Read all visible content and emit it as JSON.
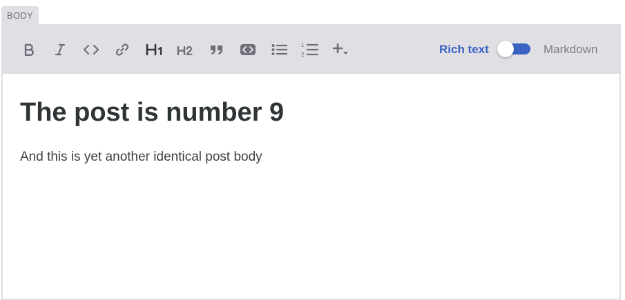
{
  "field": {
    "label": "BODY"
  },
  "toolbar": {
    "buttons": [
      {
        "name": "bold-button",
        "icon": "bold-icon"
      },
      {
        "name": "italic-button",
        "icon": "italic-icon"
      },
      {
        "name": "code-button",
        "icon": "code-icon"
      },
      {
        "name": "link-button",
        "icon": "link-icon"
      },
      {
        "name": "heading1-button",
        "icon": "heading1-icon",
        "text": "H1"
      },
      {
        "name": "heading2-button",
        "icon": "heading2-icon",
        "text": "H2"
      },
      {
        "name": "blockquote-button",
        "icon": "quote-icon"
      },
      {
        "name": "code-block-button",
        "icon": "code-block-icon"
      },
      {
        "name": "bullet-list-button",
        "icon": "bullet-list-icon"
      },
      {
        "name": "numbered-list-button",
        "icon": "numbered-list-icon"
      },
      {
        "name": "insert-more-button",
        "icon": "plus-dropdown-icon"
      }
    ],
    "mode": {
      "rich_text_label": "Rich text",
      "markdown_label": "Markdown",
      "active": "Rich text"
    }
  },
  "content": {
    "heading": "The post is number 9",
    "paragraph": "And this is yet another identical post body"
  },
  "colors": {
    "toolbar_bg": "#dfdfe4",
    "icon": "#6e6e78",
    "accent": "#3b63c4",
    "heading_text": "#2f3436"
  }
}
